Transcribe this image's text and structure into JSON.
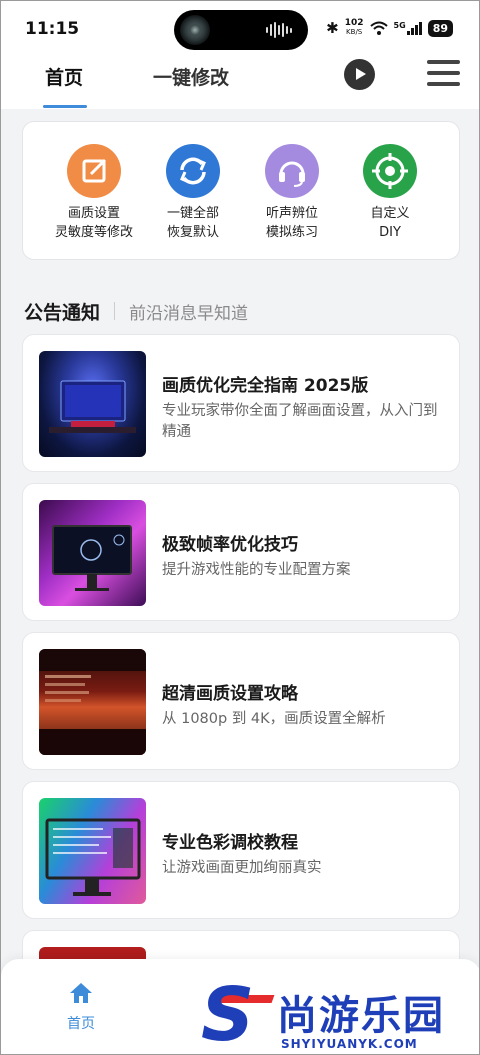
{
  "status_bar": {
    "time": "11:15",
    "network_speed": "102",
    "network_speed_unit": "KB/S",
    "signal": "5G",
    "battery": "89"
  },
  "top_nav": {
    "tabs": [
      {
        "label": "首页",
        "active": true
      },
      {
        "label": "一键修改",
        "active": false
      }
    ],
    "play_icon": "play-icon",
    "menu_icon": "menu-icon"
  },
  "quick_actions": [
    {
      "line1": "画质设置",
      "line2": "灵敏度等修改",
      "icon": "edit-icon",
      "color": "#f08c45"
    },
    {
      "line1": "一键全部",
      "line2": "恢复默认",
      "icon": "refresh-icon",
      "color": "#2f78d6"
    },
    {
      "line1": "听声辨位",
      "line2": "模拟练习",
      "icon": "headset-icon",
      "color": "#a48be0"
    },
    {
      "line1": "自定义",
      "line2": "DIY",
      "icon": "crosshair-icon",
      "color": "#29a34a"
    }
  ],
  "announcements": {
    "title": "公告通知",
    "subtitle": "前沿消息早知道",
    "items": [
      {
        "title": "画质优化完全指南 2025版",
        "desc": "专业玩家带你全面了解画面设置，从入门到精通"
      },
      {
        "title": "极致帧率优化技巧",
        "desc": "提升游戏性能的专业配置方案"
      },
      {
        "title": "超清画质设置攻略",
        "desc": "从 1080p 到 4K，画质设置全解析"
      },
      {
        "title": "专业色彩调校教程",
        "desc": "让游戏画面更加绚丽真实"
      }
    ]
  },
  "bottom_bar": {
    "home_label": "首页"
  },
  "watermark": {
    "logo_letter": "S",
    "name": "尚游乐园",
    "domain": "SHYIYUANYK.COM"
  }
}
